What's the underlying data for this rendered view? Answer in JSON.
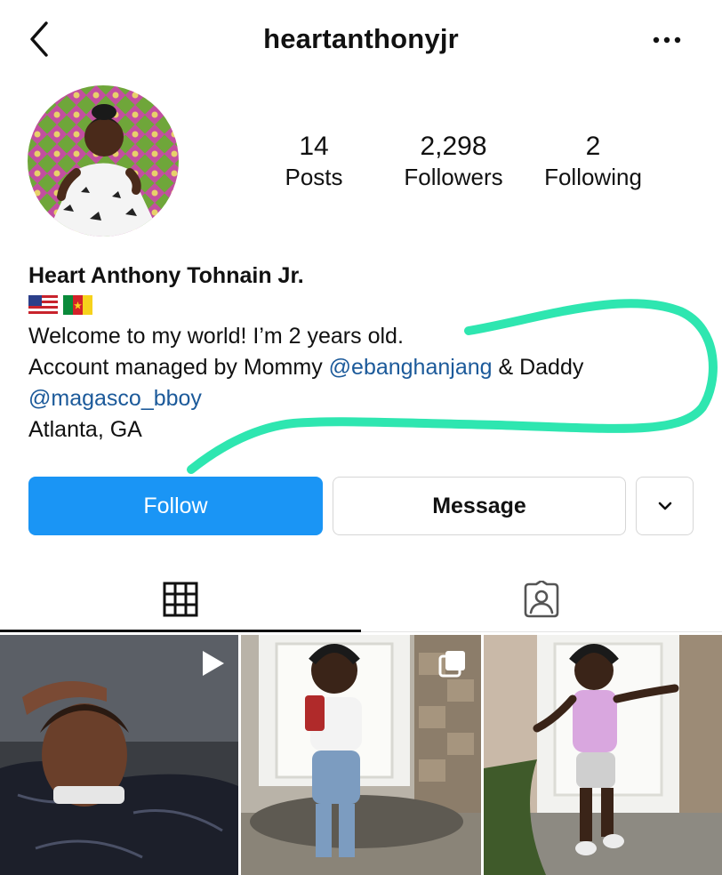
{
  "header": {
    "username": "heartanthonyjr",
    "back_icon": "chevron-left-icon",
    "more_icon": "more-horizontal-icon"
  },
  "profile": {
    "stats": [
      {
        "value": "14",
        "label": "Posts"
      },
      {
        "value": "2,298",
        "label": "Followers"
      },
      {
        "value": "2",
        "label": "Following"
      }
    ],
    "display_name": "Heart Anthony Tohnain Jr.",
    "flags": [
      "us-flag",
      "cameroon-flag"
    ],
    "bio_line1": "Welcome to my world! I’m 2 years old.",
    "bio_line2_prefix": "Account managed by Mommy ",
    "mention1": "@ebanghanjang",
    "bio_line2_mid": " & Daddy",
    "mention2": "@magasco_bboy",
    "location": "Atlanta, GA"
  },
  "actions": {
    "follow_label": "Follow",
    "message_label": "Message",
    "more_icon": "chevron-down-icon"
  },
  "tabs": [
    {
      "name": "posts-grid",
      "icon": "grid-icon",
      "active": true
    },
    {
      "name": "tagged",
      "icon": "tagged-person-icon",
      "active": false
    }
  ],
  "posts": [
    {
      "type": "reel",
      "badge": "play-icon"
    },
    {
      "type": "carousel",
      "badge": "multiple-icon"
    },
    {
      "type": "photo",
      "badge": ""
    }
  ],
  "colors": {
    "follow_button": "#1a95f5",
    "mention": "#1c5a9a",
    "scribble": "#2ee6b0"
  }
}
